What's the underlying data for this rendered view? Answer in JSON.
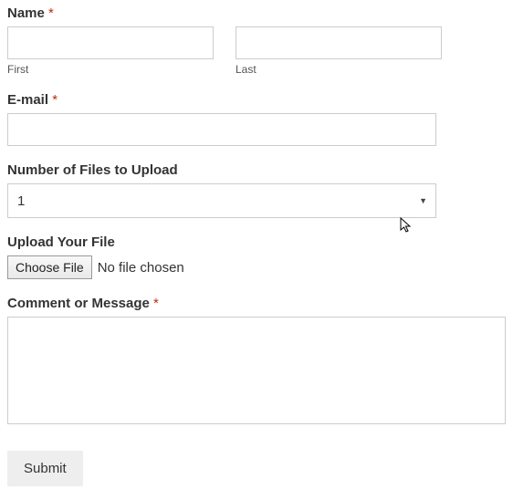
{
  "name": {
    "label": "Name",
    "required_marker": "*",
    "first_value": "",
    "first_sublabel": "First",
    "last_value": "",
    "last_sublabel": "Last"
  },
  "email": {
    "label": "E-mail",
    "required_marker": "*",
    "value": ""
  },
  "file_count": {
    "label": "Number of Files to Upload",
    "selected": "1"
  },
  "upload": {
    "label": "Upload Your File",
    "button": "Choose File",
    "status": "No file chosen"
  },
  "comment": {
    "label": "Comment or Message",
    "required_marker": "*",
    "value": ""
  },
  "submit": {
    "label": "Submit"
  }
}
